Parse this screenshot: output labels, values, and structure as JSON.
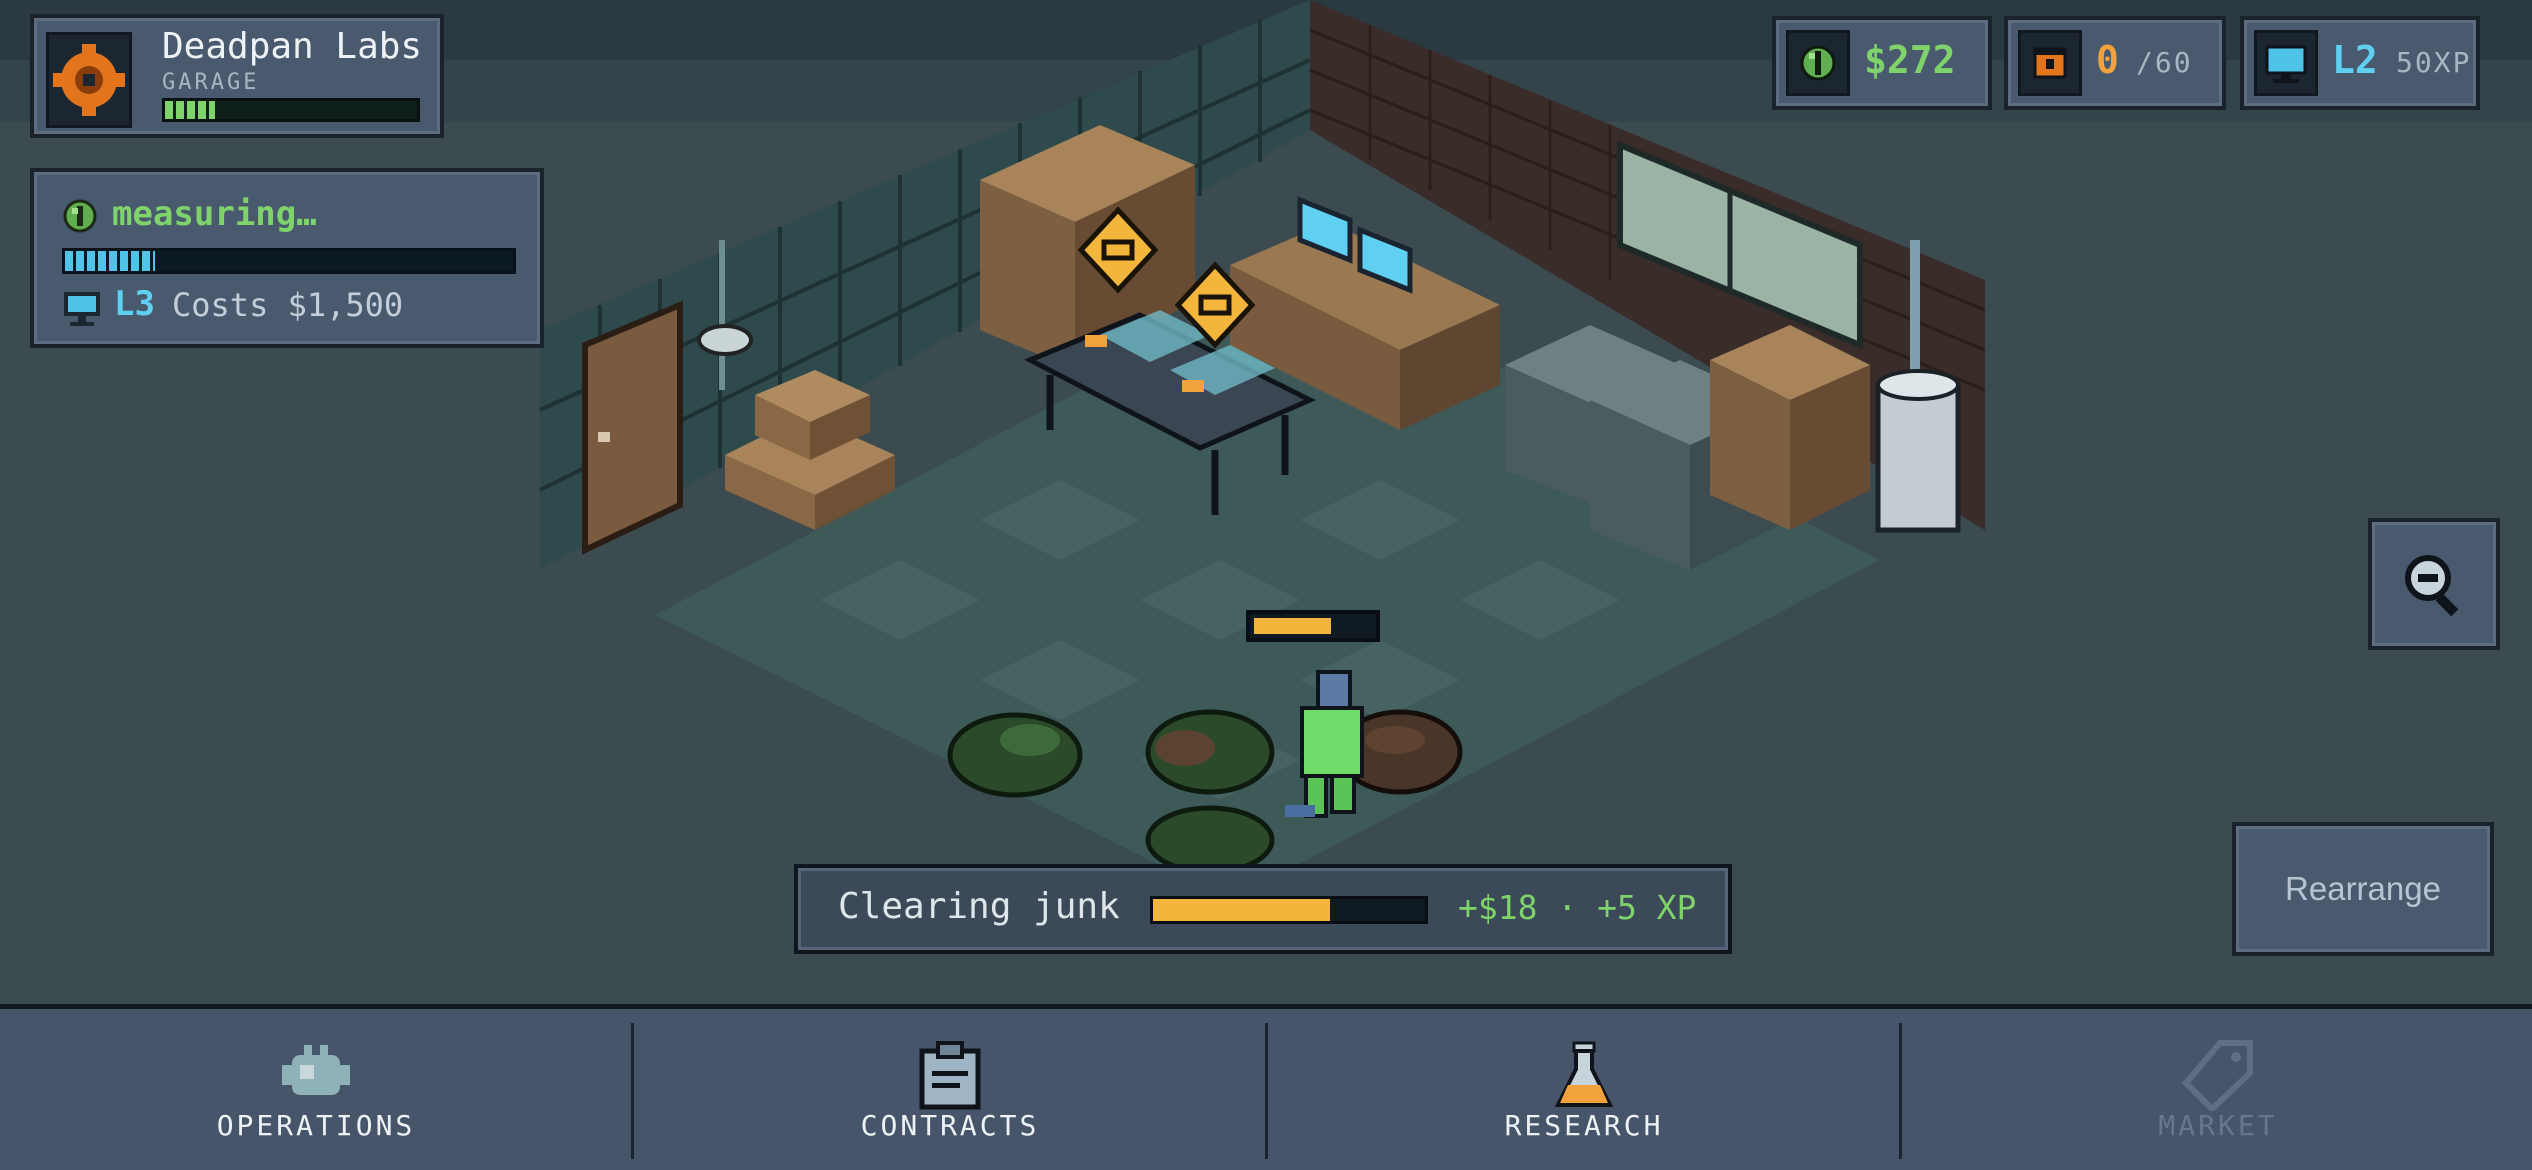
{
  "lab": {
    "name": "Deadpan Labs",
    "tier": "GARAGE",
    "progress": 0.2
  },
  "status": {
    "text": "measuring…",
    "progress": 0.2,
    "level": "L3",
    "cost": "Costs $1,500"
  },
  "stats": {
    "money": "$272",
    "storage_value": "0",
    "storage_max": "/60",
    "level": "L2",
    "xp": "50XP"
  },
  "task": {
    "label": "Clearing junk",
    "progress": 0.65,
    "reward": "+$18 · +5 XP"
  },
  "rearrange_label": "Rearrange",
  "nav": [
    {
      "label": "OPERATIONS",
      "enabled": true
    },
    {
      "label": "CONTRACTS",
      "enabled": true
    },
    {
      "label": "RESEARCH",
      "enabled": true
    },
    {
      "label": "MARKET",
      "enabled": false
    }
  ],
  "colors": {
    "accent_green": "#7ed36b",
    "accent_blue": "#5fd0f2",
    "accent_orange": "#f2a23c",
    "panel": "#4a5a6e"
  }
}
